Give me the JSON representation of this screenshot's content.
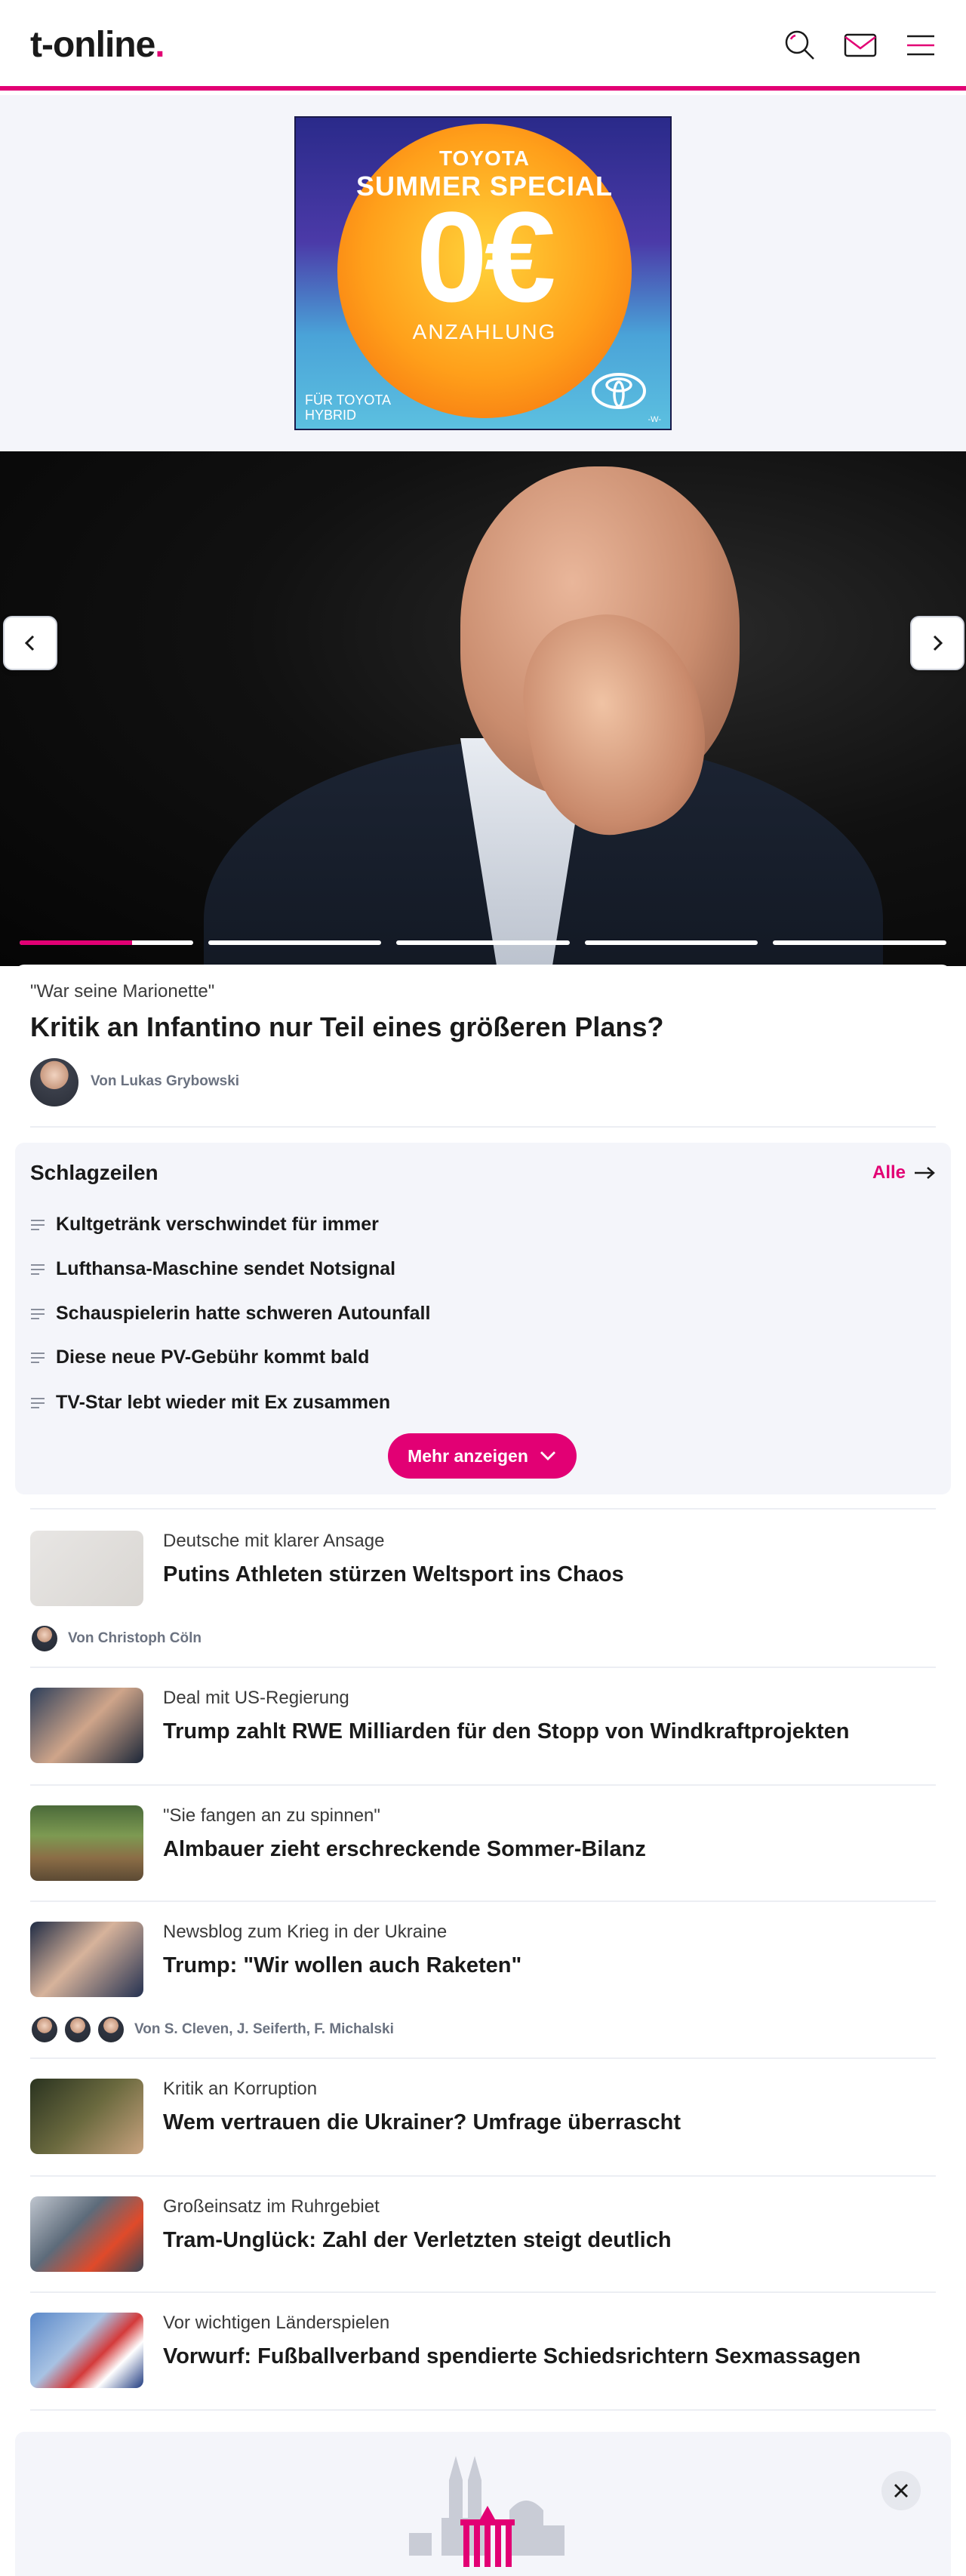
{
  "header": {
    "logo_text": "t-online",
    "logo_dot": ".",
    "icons": [
      "search-icon",
      "mail-icon",
      "menu-icon"
    ],
    "accent_color": "#e20074"
  },
  "ad": {
    "line1": "TOYOTA",
    "line2": "SUMMER SPECIAL",
    "amount": "0€",
    "line3": "ANZAHLUNG",
    "footer": "FÜR TOYOTA HYBRID",
    "mark": "-W-"
  },
  "hero": {
    "kicker": "\"War seine Marionette\"",
    "title": "Kritik an Infantino nur Teil eines größeren Plans?",
    "author": "Von Lukas Grybowski",
    "slides": [
      0.65,
      0,
      0,
      0,
      0
    ]
  },
  "headlines": {
    "title": "Schlagzeilen",
    "all_label": "Alle",
    "items": [
      "Kultgetränk verschwindet für immer",
      "Lufthansa-Maschine sendet Notsignal",
      "Schauspielerin hatte schweren Autounfall",
      "Diese neue PV-Gebühr kommt bald",
      "TV-Star lebt wieder mit Ex zusammen"
    ],
    "more_label": "Mehr anzeigen"
  },
  "news": [
    {
      "kicker": "Deutsche mit klarer Ansage",
      "title": "Putins Athleten stürzen Weltsport ins Chaos",
      "author": "Von Christoph Cöln"
    },
    {
      "kicker": "Deal mit US-Regierung",
      "title": "Trump zahlt RWE Milliarden für den Stopp von Windkraftprojekten",
      "author": ""
    },
    {
      "kicker": "\"Sie fangen an zu spinnen\"",
      "title": "Almbauer zieht erschreckende Sommer-Bilanz",
      "author": ""
    },
    {
      "kicker": "Newsblog zum Krieg in der Ukraine",
      "title": "Trump: \"Wir wollen auch Raketen\"",
      "author": "Von S. Cleven, J. Seiferth, F. Michalski"
    },
    {
      "kicker": "Kritik an Korruption",
      "title": "Wem vertrauen die Ukrainer? Umfrage überrascht",
      "author": ""
    },
    {
      "kicker": "Großeinsatz im Ruhrgebiet",
      "title": "Tram-Unglück: Zahl der Verletzten steigt deutlich",
      "author": ""
    },
    {
      "kicker": "Vor wichtigen Länderspielen",
      "title": "Vorwurf: Fußballverband spendierte Schiedsrichtern Sexmassagen",
      "author": ""
    }
  ]
}
